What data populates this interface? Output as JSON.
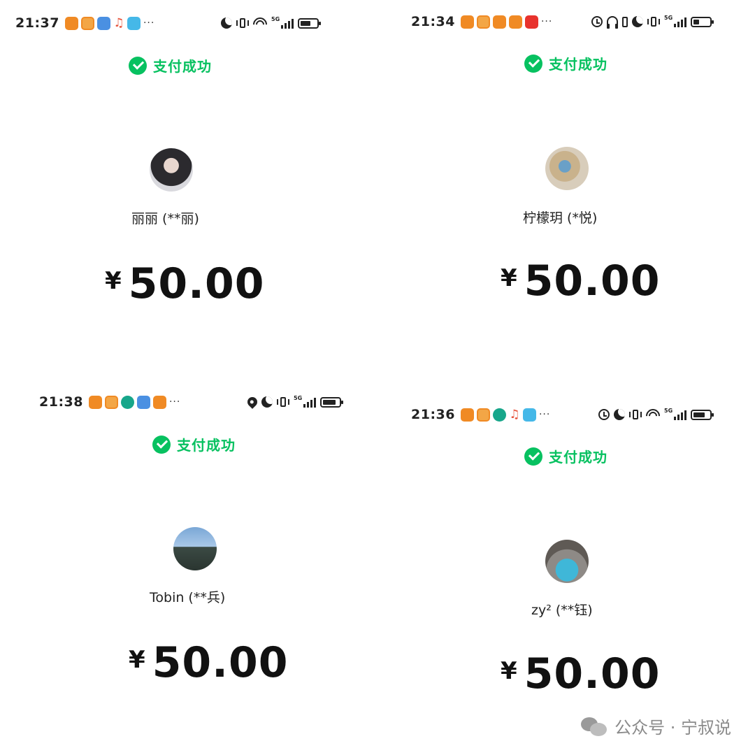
{
  "panels": [
    {
      "time": "21:37",
      "more": "···",
      "status": "支付成功",
      "payee": "丽丽 (**丽)",
      "currency": "¥",
      "amount": "50.00"
    },
    {
      "time": "21:34",
      "more": "···",
      "status": "支付成功",
      "payee": "柠檬玥 (*悦)",
      "currency": "¥",
      "amount": "50.00"
    },
    {
      "time": "21:38",
      "more": "···",
      "status": "支付成功",
      "payee": "Tobin (**兵)",
      "currency": "¥",
      "amount": "50.00"
    },
    {
      "time": "21:36",
      "more": "···",
      "status": "支付成功",
      "payee": "zy² (**钰)",
      "currency": "¥",
      "amount": "50.00"
    }
  ],
  "colors": {
    "success_green": "#07c160"
  },
  "watermark": {
    "text": "公众号 · 宁叔说"
  }
}
